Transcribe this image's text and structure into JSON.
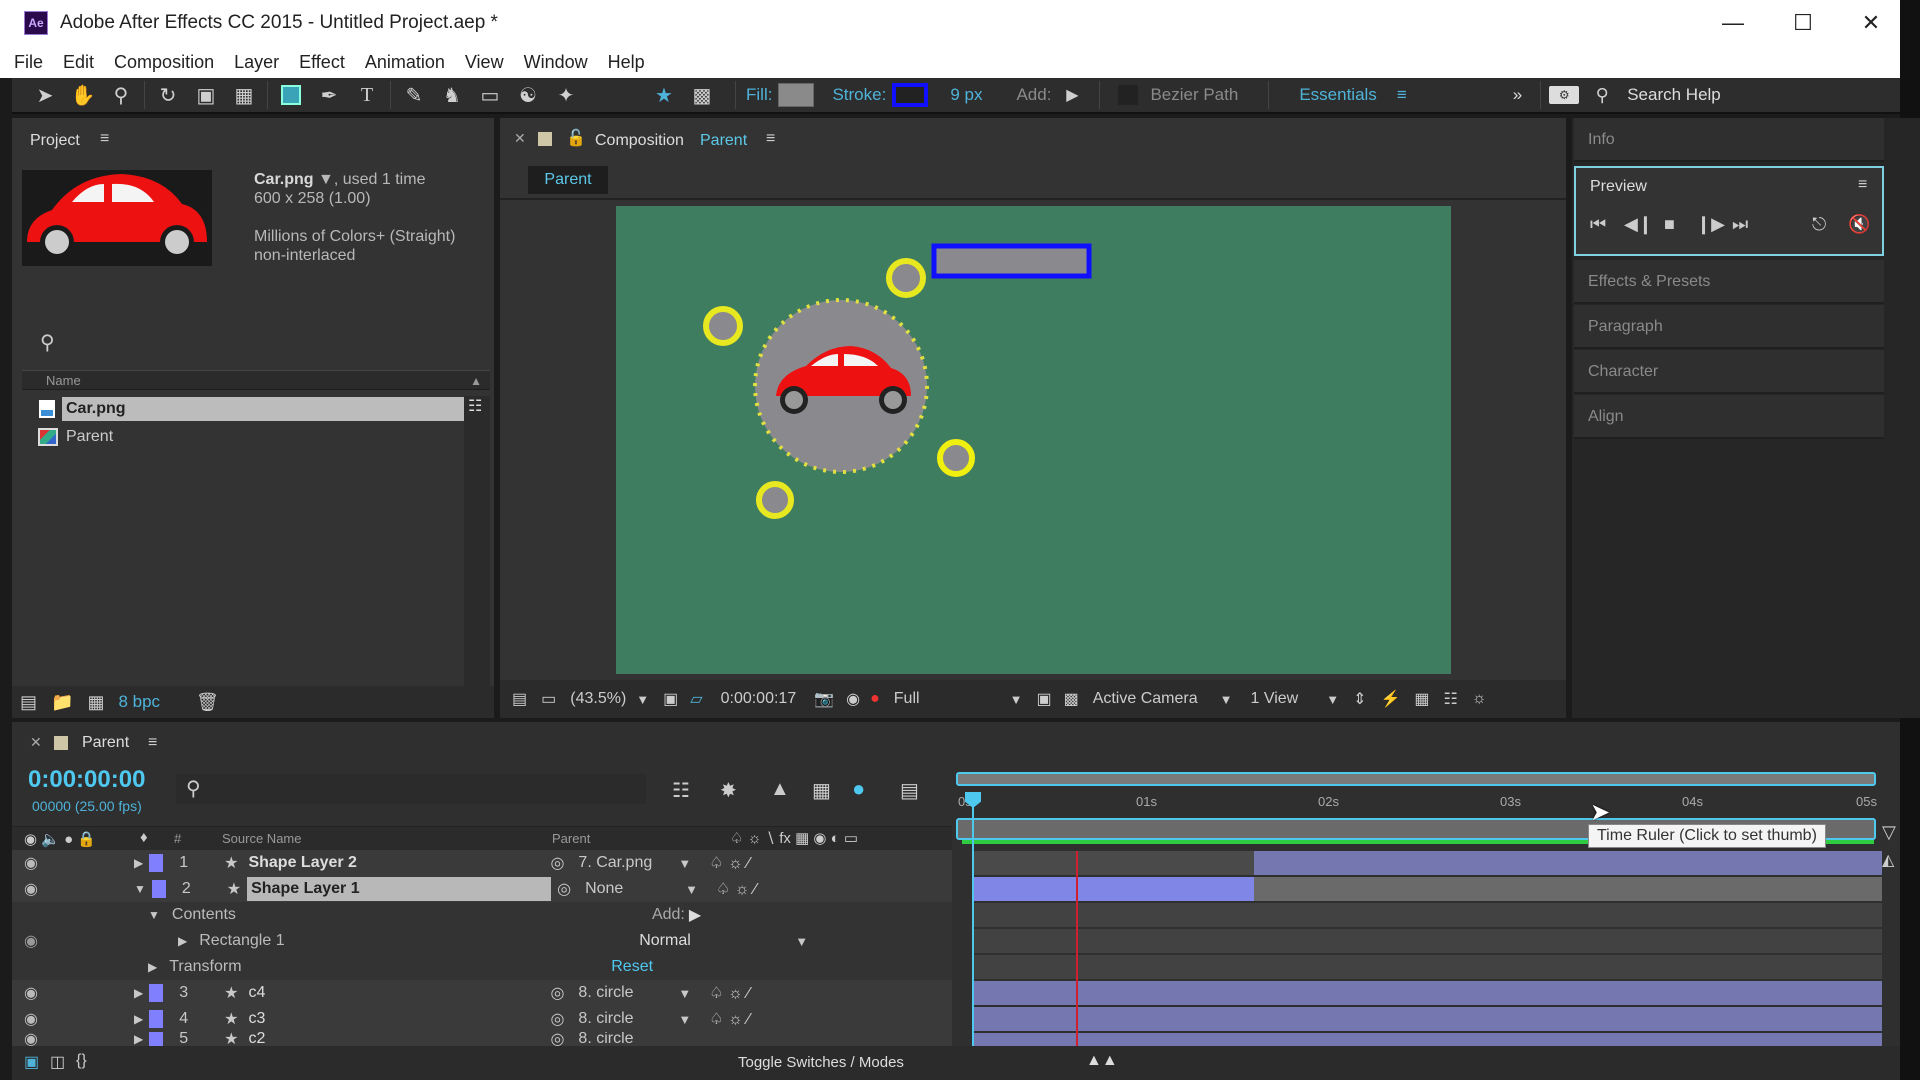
{
  "window": {
    "app_badge": "Ae",
    "title": "Adobe After Effects CC 2015 - Untitled Project.aep *",
    "controls": [
      "minimize",
      "maximize",
      "close"
    ]
  },
  "menu": [
    "File",
    "Edit",
    "Composition",
    "Layer",
    "Effect",
    "Animation",
    "View",
    "Window",
    "Help"
  ],
  "toolbar": {
    "tools": [
      "selection-tool",
      "hand-tool",
      "zoom-tool",
      "rotation-tool",
      "camera-tool",
      "pan-behind-tool",
      "rectangle-tool",
      "pen-tool",
      "type-tool",
      "brush-tool",
      "clone-stamp-tool",
      "eraser-tool",
      "roto-brush-tool",
      "puppet-pin-tool"
    ],
    "fill_label": "Fill:",
    "stroke_label": "Stroke:",
    "stroke_width": "9 px",
    "add_label": "Add:",
    "bezier_path_label": "Bezier Path",
    "workspace": "Essentials",
    "search_help": "Search Help",
    "colors": {
      "fill": "#8a8a8a",
      "stroke": "#1010ff",
      "accent": "#4fb3d9"
    }
  },
  "project": {
    "title": "Project",
    "asset_name": "Car.png",
    "asset_usage": ", used 1 time",
    "asset_dims": "600 x 258 (1.00)",
    "asset_colors": "Millions of Colors+ (Straight)",
    "asset_interlace": "non-interlaced",
    "column_name": "Name",
    "items": [
      {
        "name": "Car.png",
        "type": "footage",
        "selected": true
      },
      {
        "name": "Parent",
        "type": "composition",
        "selected": false
      }
    ],
    "bpc": "8 bpc"
  },
  "composition": {
    "tab_prefix": "Composition",
    "tab_name": "Parent",
    "breadcrumb": "Parent",
    "zoom": "(43.5%)",
    "timecode": "0:00:00:17",
    "resolution": "Full",
    "camera": "Active Camera",
    "views": "1 View",
    "background_color": "#3f7d60"
  },
  "right_panels": {
    "info": "Info",
    "preview": "Preview",
    "effects_presets": "Effects & Presets",
    "paragraph": "Paragraph",
    "character": "Character",
    "align": "Align"
  },
  "timeline": {
    "comp_name": "Parent",
    "current_time": "0:00:00:00",
    "frame_info": "00000 (25.00 fps)",
    "col_num": "#",
    "col_source_name": "Source Name",
    "col_parent": "Parent",
    "ruler_labels": [
      "0s",
      "01s",
      "02s",
      "03s",
      "04s",
      "05s"
    ],
    "tooltip": "Time Ruler (Click to set thumb)",
    "toggle_label": "Toggle Switches / Modes",
    "layers": [
      {
        "num": "1",
        "name": "Shape Layer 2",
        "parent": "7. Car.png",
        "expanded": false,
        "selected": false
      },
      {
        "num": "2",
        "name": "Shape Layer 1",
        "parent": "None",
        "expanded": true,
        "selected": true
      },
      {
        "num": "3",
        "name": "c4",
        "parent": "8. circle",
        "expanded": false,
        "selected": false
      },
      {
        "num": "4",
        "name": "c3",
        "parent": "8. circle",
        "expanded": false,
        "selected": false
      },
      {
        "num": "5",
        "name": "c2",
        "parent": "8. circle",
        "expanded": false,
        "selected": false
      }
    ],
    "contents_label": "Contents",
    "add_label": "Add:",
    "rectangle_label": "Rectangle 1",
    "blend_mode": "Normal",
    "transform_label": "Transform",
    "reset_label": "Reset"
  }
}
